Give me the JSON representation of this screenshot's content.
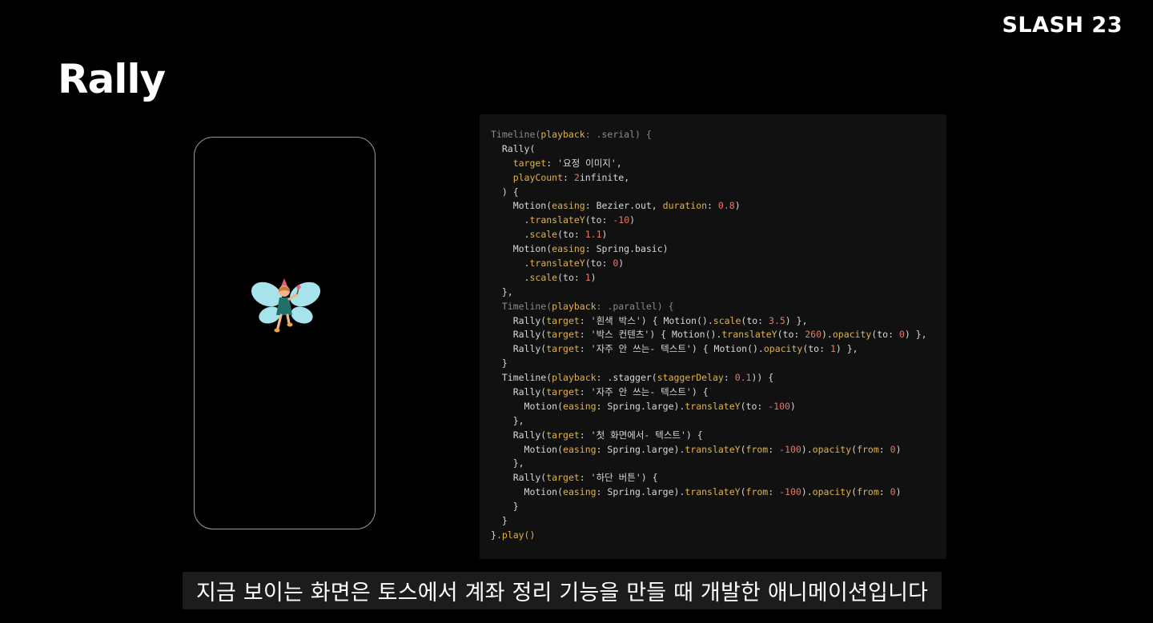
{
  "brand": "SLASH 23",
  "slide_title": "Rally",
  "phone": {
    "illustration": "fairy-icon"
  },
  "code": {
    "lines": [
      "Timeline(playback: .serial) {",
      "  Rally(",
      "    target: '요정 이미지',",
      "    playCount: 2infinite,",
      "  ) {",
      "    Motion(easing: Bezier.out, duration: 0.8)",
      "      .translateY(to: -10)",
      "      .scale(to: 1.1)",
      "    Motion(easing: Spring.basic)",
      "      .translateY(to: 0)",
      "      .scale(to: 1)",
      "  },",
      "  Timeline(playback: .parallel) {",
      "    Rally(target: '흰색 박스') { Motion().scale(to: 3.5) },",
      "    Rally(target: '박스 컨텐츠') { Motion().translateY(to: 260).opacity(to: 0) },",
      "    Rally(target: '자주 안 쓰는- 텍스트') { Motion().opacity(to: 1) },",
      "  }",
      "  Timeline(playback: .stagger(staggerDelay: 0.1)) {",
      "    Rally(target: '자주 안 쓰는- 텍스트') {",
      "      Motion(easing: Spring.large).translateY(to: -100)",
      "    },",
      "    Rally(target: '첫 화면에서- 텍스트') {",
      "      Motion(easing: Spring.large).translateY(from: -100).opacity(from: 0)",
      "    },",
      "    Rally(target: '하단 버튼') {",
      "      Motion(easing: Spring.large).translateY(from: -100).opacity(from: 0)",
      "    }",
      "  }",
      "}.play()"
    ]
  },
  "subtitle": "지금 보이는 화면은 토스에서 계좌 정리 기능을 만들 때 개발한 애니메이션입니다",
  "colors": {
    "background": "#000000",
    "code_panel": "#111111",
    "keyword": "#e0b34a",
    "number": "#e27a6a",
    "text": "#d8d8d8",
    "dim": "#8a8a8a"
  }
}
